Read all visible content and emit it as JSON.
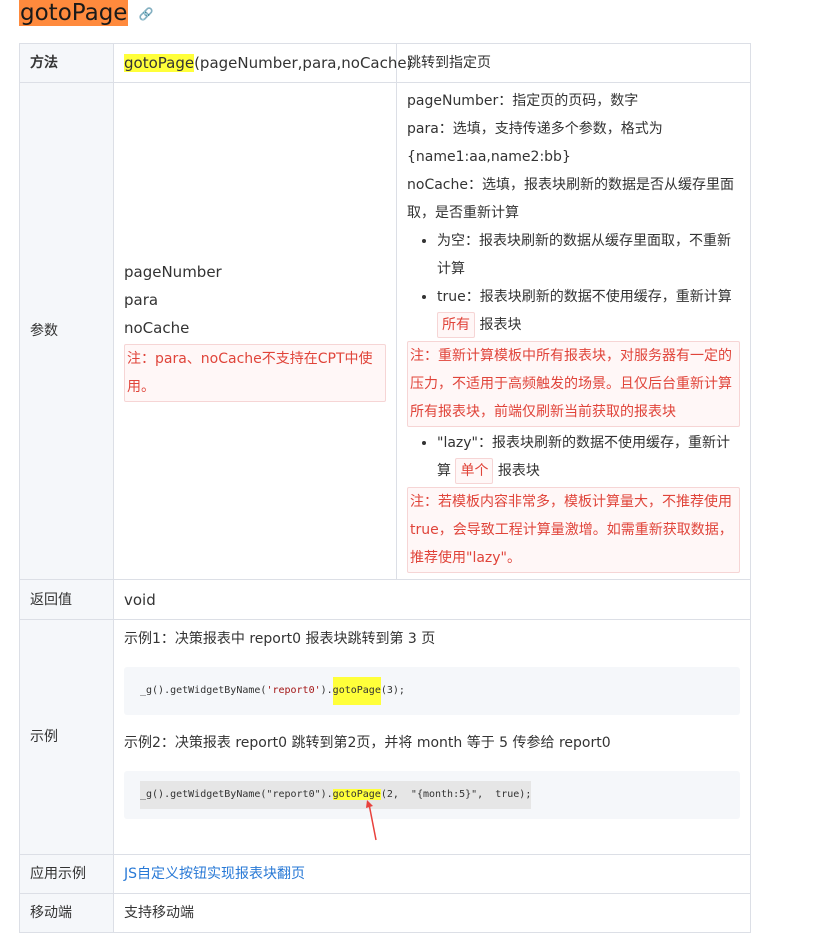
{
  "title": "gotoPage",
  "link_icon": "link-icon",
  "method": {
    "label": "方法",
    "name": "gotoPage",
    "signature_rest": "(pageNumber,para,noCache)",
    "desc": "跳转到指定页"
  },
  "params": {
    "label": "参数",
    "names": [
      "pageNumber",
      "para",
      "noCache"
    ],
    "note": "注：para、noCache不支持在CPT中使用。",
    "desc_pageNumber": "pageNumber：指定页的页码，数字",
    "desc_para": "para：选填，支持传递多个参数，格式为{name1:aa,name2:bb}",
    "desc_noCache": "noCache：选填，报表块刷新的数据是否从缓存里面取，是否重新计算",
    "bullet1": "为空：报表块刷新的数据从缓存里面取，不重新计算",
    "bullet2_pre": "true：报表块刷新的数据不使用缓存，重新计算",
    "bullet2_tag": "所有",
    "bullet2_post": "报表块",
    "note2": "注：重新计算模板中所有报表块，对服务器有一定的压力，不适用于高频触发的场景。且仅后台重新计算所有报表块，前端仅刷新当前获取的报表块",
    "bullet3_pre": "\"lazy\"：报表块刷新的数据不使用缓存，重新计算",
    "bullet3_tag": "单个",
    "bullet3_post": "报表块",
    "note3": "注：若模板内容非常多，模板计算量大，不推荐使用true，会导致工程计算量激增。如需重新获取数据，推荐使用\"lazy\"。"
  },
  "returns": {
    "label": "返回值",
    "value": "void"
  },
  "example": {
    "label": "示例",
    "ex1_text": "示例1：决策报表中 report0 报表块跳转到第 3 页",
    "ex1_code_a": "_g().getWidgetByName(",
    "ex1_code_str": "'report0'",
    "ex1_code_b": ").",
    "ex1_code_fn": "gotoPage",
    "ex1_code_c": "(3);",
    "ex2_text": "示例2：决策报表 report0 跳转到第2页，并将 month 等于 5 传参给 report0",
    "ex2_code_a": "_g().getWidgetByName(\"report0\").",
    "ex2_code_fn": "gotoPage",
    "ex2_code_c": "(2,  \"{month:5}\",  true);"
  },
  "usage": {
    "label": "应用示例",
    "link": "JS自定义按钮实现报表块翻页"
  },
  "mobile": {
    "label": "移动端",
    "value": "支持移动端"
  },
  "colors": {
    "highlight": "#ffff3a",
    "title_bg": "#ff8a3d",
    "note_red": "#e0443a",
    "link_blue": "#2879d6"
  }
}
